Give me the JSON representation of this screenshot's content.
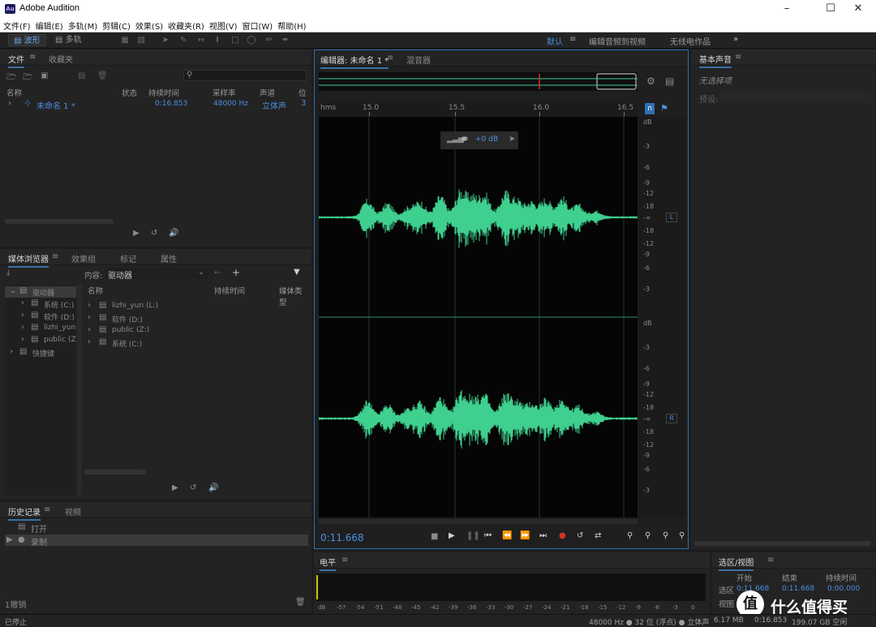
{
  "window": {
    "app_icon": "Au",
    "title": "Adobe Audition",
    "minimize_icon": "minimize-icon",
    "maximize_icon": "maximize-icon",
    "close_icon": "close-icon"
  },
  "menubar": [
    "文件(F)",
    "编辑(E)",
    "多轨(M)",
    "剪辑(C)",
    "效果(S)",
    "收藏夹(R)",
    "视图(V)",
    "窗口(W)",
    "帮助(H)"
  ],
  "toolbar": {
    "waveform_label": "波形",
    "multitrack_label": "多轨",
    "workspaces": {
      "default": "默认",
      "edit_audio_video": "编辑音频到视频",
      "radio": "无线电作品"
    }
  },
  "files_panel": {
    "tabs": [
      "文件",
      "收藏夹"
    ],
    "columns": [
      "名称",
      "状态",
      "持续时间",
      "采样率",
      "声道",
      "位"
    ],
    "row": {
      "name": "未命名 1 *",
      "duration": "0:16.853",
      "sample_rate": "48000 Hz",
      "channels": "立体声",
      "bits": "3"
    }
  },
  "media_panel": {
    "tabs": [
      "媒体浏览器",
      "效果组",
      "标记",
      "属性"
    ],
    "content_label": "内容:",
    "content_value": "驱动器",
    "columns": [
      "名称",
      "持续时间",
      "媒体类型"
    ],
    "tree": [
      {
        "label": "驱动器",
        "indent": 0
      },
      {
        "label": "系统 (C:)",
        "indent": 1
      },
      {
        "label": "软件 (D:)",
        "indent": 1
      },
      {
        "label": "lizhi_yun",
        "indent": 1
      },
      {
        "label": "public (Z:)",
        "indent": 1
      },
      {
        "label": "快捷键",
        "indent": 0
      }
    ],
    "list": [
      "lizhi_yun (L:)",
      "软件 (D:)",
      "public (Z:)",
      "系统 (C:)"
    ]
  },
  "history_panel": {
    "tabs": [
      "历史记录",
      "视频"
    ],
    "items": [
      "打开",
      "录制"
    ],
    "undo_label": "1撤销"
  },
  "editor": {
    "tabs": [
      "编辑器: 未命名 1 *",
      "混音器"
    ],
    "ruler_unit": "hms",
    "ruler_ticks": [
      "15.0",
      "15.5",
      "16.0",
      "16.5"
    ],
    "hud_gain": "+0 dB",
    "db_labels_top": [
      "dB",
      "-3",
      "-6",
      "-9",
      "-12",
      "-18",
      "-∞",
      "-18",
      "-12",
      "-9",
      "-6",
      "-3"
    ],
    "db_labels_bottom": [
      "dB",
      "-3",
      "-6",
      "-9",
      "-12",
      "-18",
      "-∞",
      "-18",
      "-12",
      "-9",
      "-6",
      "-3"
    ],
    "channel_left": "L",
    "channel_right": "R",
    "current_time": "0:11.668"
  },
  "essential_sound": {
    "title": "基本声音",
    "no_selection": "无选择项",
    "preset_label": "预设:"
  },
  "levels": {
    "title": "电平",
    "scale": [
      "dB",
      "-57",
      "-54",
      "-51",
      "-48",
      "-45",
      "-42",
      "-39",
      "-36",
      "-33",
      "-30",
      "-27",
      "-24",
      "-21",
      "-18",
      "-15",
      "-12",
      "-9",
      "-6",
      "-3",
      "0"
    ]
  },
  "selection_view": {
    "title": "选区/视图",
    "col_start": "开始",
    "col_end": "结束",
    "col_duration": "持续时间",
    "row_selection": "选区",
    "row_view": "视图",
    "sel_start": "0:11.668",
    "sel_end": "0:11.668",
    "sel_duration": "0:00.000"
  },
  "status": {
    "left": "已停止",
    "format": "48000 Hz ● 32 位 (浮点) ● 立体声",
    "size": "6.17 MB",
    "duration": "0:16.853",
    "free": "199.07 GB 空闲"
  },
  "watermark": "值 什么值得买",
  "colors": {
    "waveform": "#3fcf8e",
    "accent": "#4a90e2",
    "playhead": "#d9302c"
  }
}
